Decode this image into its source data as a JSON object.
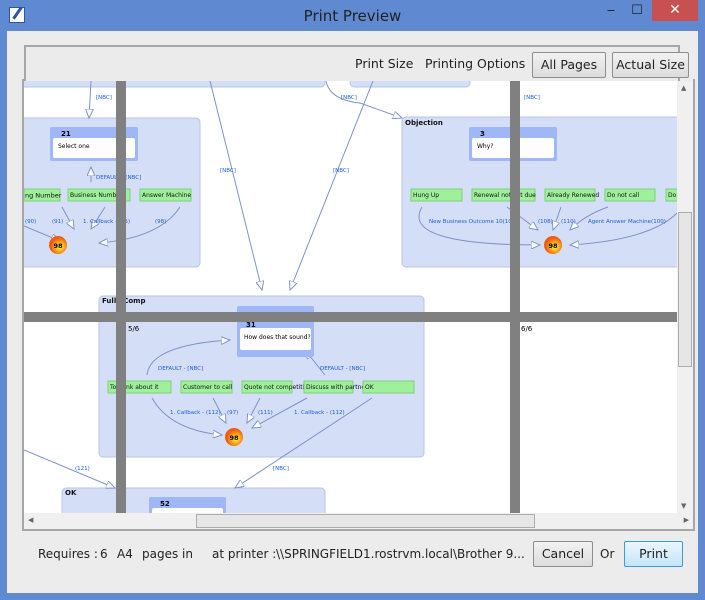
{
  "window": {
    "title": "Print Preview",
    "minimize": "‒",
    "maximize": "☐",
    "close": "✕"
  },
  "toolbar": {
    "print_size": "Print Size",
    "printing_options": "Printing Options",
    "all_pages": "All Pages",
    "actual_size": "Actual Size"
  },
  "diagram": {
    "nbc": "[NBC]",
    "default_nbc": "DEFAULT - [NBC]",
    "left_group": {
      "node_id": "21",
      "node_text": "Select one",
      "outcomes": [
        "ng Number",
        "Business Number",
        "Answer Machine"
      ],
      "labels": [
        "(90)",
        "(91)",
        "1. Callback - (95)",
        "(98)"
      ],
      "end": "98"
    },
    "objection": {
      "title": "Objection",
      "node_id": "3",
      "node_text": "Why?",
      "outcomes": [
        "Hung Up",
        "Renewal not yet due",
        "Already Renewed",
        "Do not call",
        "Do"
      ],
      "labels": [
        "New Business Outcome 10(102)",
        "(108)",
        "(110)",
        "Agent Answer Machine(100)"
      ],
      "end": "98"
    },
    "fully_comp": {
      "title": "Fully Comp",
      "node_id": "31",
      "node_text": "How does that sound?",
      "outcomes": [
        "To think about it",
        "Customer to call",
        "Quote not competitive",
        "Discuss with partner",
        "OK"
      ],
      "labels": [
        "1. Callback - (112)",
        "(97)",
        "(111)",
        "1. Callback - (112)"
      ],
      "end": "98"
    },
    "ok_group": {
      "title": "OK",
      "node_id": "52"
    },
    "edge_121": "(121)",
    "pages": [
      "5/6",
      "6/6"
    ]
  },
  "footer": {
    "requires": "Requires :",
    "count": "6",
    "paper": "A4",
    "pages": "pages",
    "in": "in",
    "at_printer": "at printer :",
    "printer": "\\\\SPRINGFIELD1.rostrvm.local\\Brother 9...",
    "cancel": "Cancel",
    "or": "Or",
    "print": "Print"
  },
  "colors": {
    "titlebar": "#5f8ad1",
    "group": "#d5def7",
    "node_header": "#9fb6f7",
    "outcome": "#9ef19a",
    "edge_label": "#1a5fd0"
  }
}
